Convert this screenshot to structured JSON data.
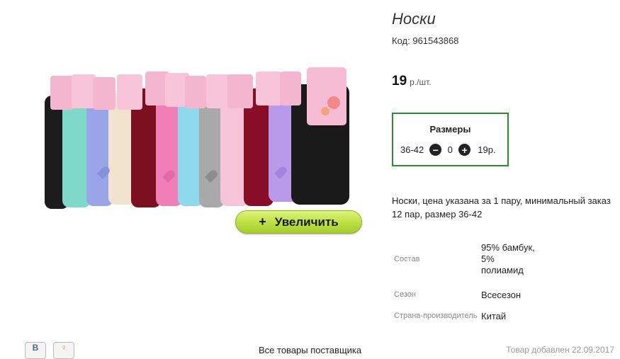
{
  "product": {
    "title": "Носки",
    "code_label": "Код:",
    "code": "961543868",
    "price_value": "19",
    "price_currency": "р.",
    "price_unit": "/шт.",
    "zoom_button_label": "Увеличить",
    "zoom_plus": "+",
    "sizes": {
      "title": "Размеры",
      "rows": [
        {
          "size": "36-42",
          "quantity": "0",
          "price": "19р."
        }
      ],
      "minus_icon": "minus-circle-icon",
      "plus_icon": "plus-circle-icon"
    },
    "description": "Носки, цена указана за 1 пару, минимальный заказ 12 пар, размер 36-42",
    "specs": {
      "composition_label": "Состав",
      "composition_value": "95% бамбук, 5% полиамид",
      "season_label": "Сезон",
      "season_value": "Всесезон",
      "country_label": "Страна-производитель",
      "country_value": "Китай"
    }
  },
  "footer": {
    "vk_letter": "В",
    "ok_letter": "♀",
    "all_supplier_link": "Все товары поставщика",
    "date_added": "Товар добавлен 22.09.2017"
  },
  "colors": {
    "sizes_border": "#2a8f2a",
    "zoom_button": "#bfe046"
  }
}
